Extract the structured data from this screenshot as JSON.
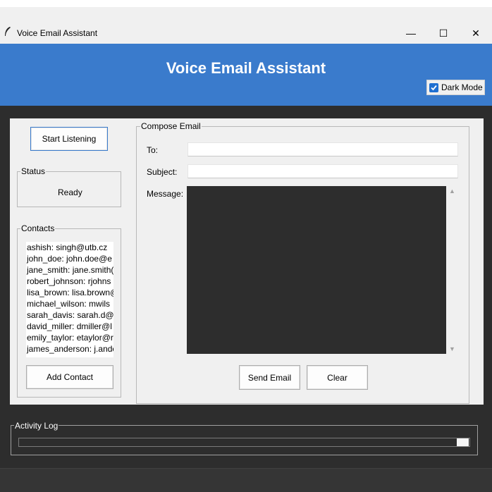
{
  "window": {
    "title": "Voice Email Assistant",
    "controls": {
      "minimize": "—",
      "maximize": "☐",
      "close": "✕"
    }
  },
  "header": {
    "title": "Voice Email Assistant",
    "background_color": "#3a7bcc",
    "dark_mode": {
      "label": "Dark Mode",
      "checked": true
    }
  },
  "left_panel": {
    "start_button": "Start Listening",
    "status": {
      "group_label": "Status",
      "value": "Ready"
    },
    "contacts": {
      "group_label": "Contacts",
      "items": [
        "ashish: singh@utb.cz",
        "john_doe: john.doe@e",
        "jane_smith: jane.smith(",
        "robert_johnson: rjohns",
        "lisa_brown: lisa.brown@",
        "michael_wilson: mwils",
        "sarah_davis: sarah.d@u",
        "david_miller: dmiller@l",
        "emily_taylor: etaylor@r",
        "james_anderson: j.ande"
      ],
      "add_button": "Add Contact"
    }
  },
  "compose": {
    "group_label": "Compose Email",
    "to_label": "To:",
    "to_value": "",
    "subject_label": "Subject:",
    "subject_value": "",
    "message_label": "Message:",
    "message_value": "",
    "send_button": "Send Email",
    "clear_button": "Clear"
  },
  "activity_log": {
    "label": "Activity Log"
  },
  "colors": {
    "accent": "#3a7bcc",
    "dark_background": "#2d2d2d",
    "panel_background": "#f0f0f0"
  }
}
